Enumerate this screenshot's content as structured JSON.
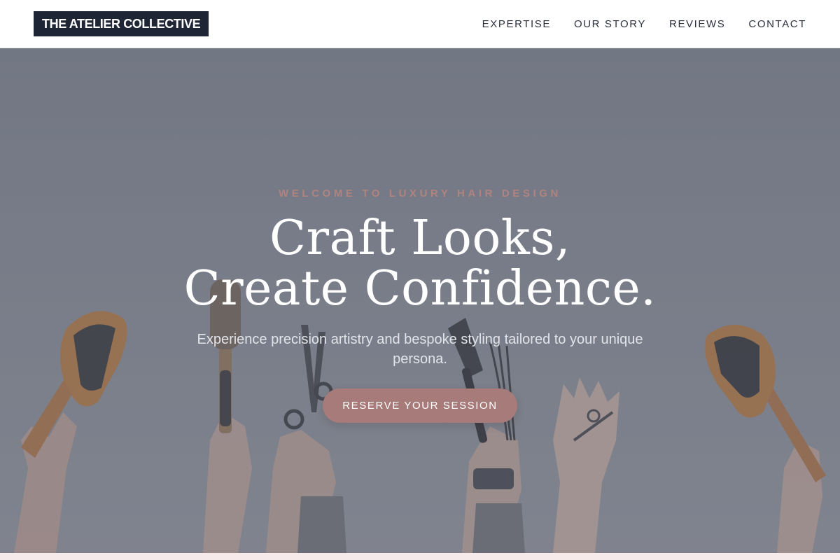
{
  "header": {
    "logo_text": "THE ATELIER COLLECTIVE",
    "nav": [
      {
        "label": "EXPERTISE"
      },
      {
        "label": "OUR STORY"
      },
      {
        "label": "REVIEWS"
      },
      {
        "label": "CONTACT"
      }
    ]
  },
  "hero": {
    "eyebrow": "WELCOME TO LUXURY HAIR DESIGN",
    "headline_line1": "Craft Looks,",
    "headline_line2": "Create Confidence.",
    "subtext": "Experience precision artistry and bespoke styling tailored to your unique persona.",
    "cta_label": "RESERVE YOUR SESSION",
    "background_image_icon": "hands-holding-hair-tools-photo"
  },
  "colors": {
    "logo_background": "#1e2535",
    "accent": "#a67b79",
    "eyebrow": "#b0837f",
    "hero_overlay": "#7a7e8a"
  }
}
